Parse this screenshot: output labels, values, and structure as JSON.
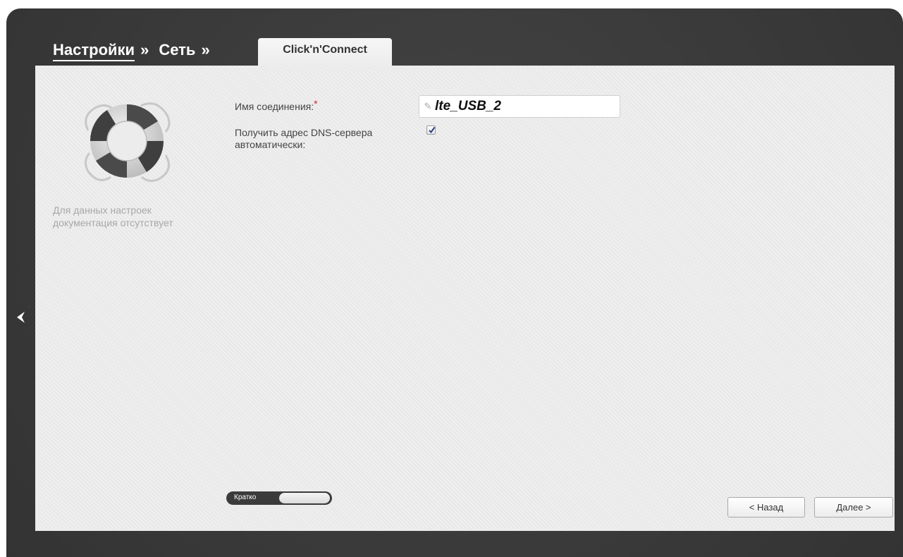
{
  "breadcrumb": {
    "settings": "Настройки",
    "network": "Сеть",
    "separator": "»"
  },
  "tab": {
    "label": "Click'n'Connect"
  },
  "help": {
    "note": "Для данных настроек документация отсутствует",
    "icon": "lifebuoy-icon"
  },
  "form": {
    "connection_name_label": "Имя соединения:",
    "required_mark": "*",
    "connection_name_value": "lte_USB_2",
    "dns_auto_label": "Получить адрес DNS-сервера автоматически:",
    "dns_auto_checked": true
  },
  "mode_toggle": {
    "label": "Кратко"
  },
  "buttons": {
    "back": "< Назад",
    "next": "Далее >"
  },
  "colors": {
    "frame": "#3a3a3a",
    "panel": "#ececec",
    "required": "#e02020"
  }
}
